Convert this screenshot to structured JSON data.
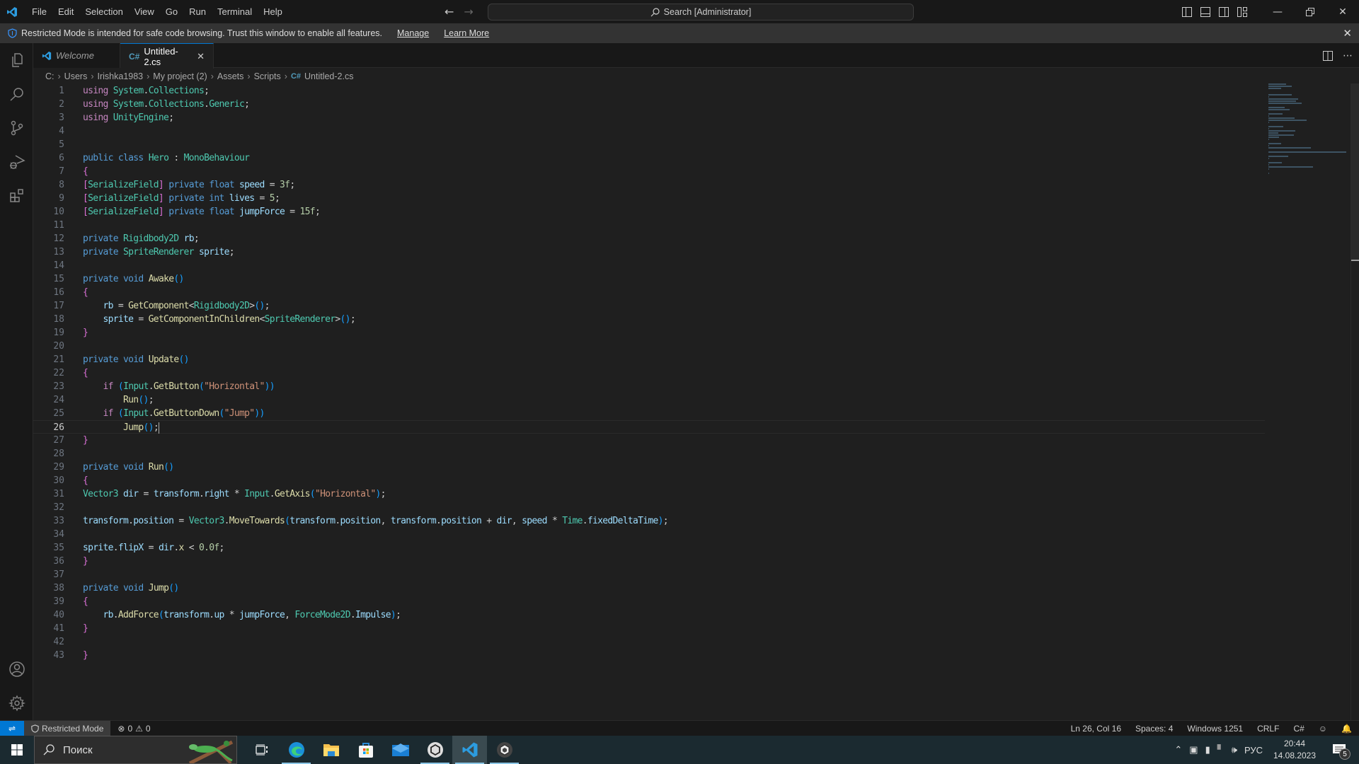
{
  "titlebar": {
    "menu": [
      "File",
      "Edit",
      "Selection",
      "View",
      "Go",
      "Run",
      "Terminal",
      "Help"
    ],
    "search_placeholder": "Search [Administrator]"
  },
  "banner": {
    "message": "Restricted Mode is intended for safe code browsing. Trust this window to enable all features.",
    "manage": "Manage",
    "learn_more": "Learn More"
  },
  "tabs": [
    {
      "label": "Welcome",
      "active": false
    },
    {
      "label": "Untitled-2.cs",
      "active": true
    }
  ],
  "breadcrumb": [
    "C:",
    "Users",
    "Irishka1983",
    "My project (2)",
    "Assets",
    "Scripts",
    "Untitled-2.cs"
  ],
  "editor": {
    "current_line": 26,
    "lines": [
      "using System.Collections;",
      "using System.Collections.Generic;",
      "using UnityEngine;",
      "",
      "",
      "public class Hero : MonoBehaviour",
      "{",
      "[SerializeField] private float speed = 3f;",
      "[SerializeField] private int lives = 5;",
      "[SerializeField] private float jumpForce = 15f;",
      "",
      "private Rigidbody2D rb;",
      "private SpriteRenderer sprite;",
      "",
      "private void Awake()",
      "{",
      "    rb = GetComponent<Rigidbody2D>();",
      "    sprite = GetComponentInChildren<SpriteRenderer>();",
      "}",
      "",
      "private void Update()",
      "{",
      "    if (Input.GetButton(\"Horizontal\"))",
      "        Run();",
      "    if (Input.GetButtonDown(\"Jump\"))",
      "        Jump();",
      "}",
      "",
      "private void Run()",
      "{",
      "Vector3 dir = transform.right * Input.GetAxis(\"Horizontal\");",
      "",
      "transform.position = Vector3.MoveTowards(transform.position, transform.position + dir, speed * Time.fixedDeltaTime);",
      "",
      "sprite.flipX = dir.x < 0.0f;",
      "}",
      "",
      "private void Jump()",
      "{",
      "    rb.AddForce(transform.up * jumpForce, ForceMode2D.Impulse);",
      "}",
      "",
      "}"
    ]
  },
  "statusbar": {
    "restricted": "Restricted Mode",
    "errors": "0",
    "warnings": "0",
    "position": "Ln 26, Col 16",
    "spaces": "Spaces: 4",
    "encoding": "Windows 1251",
    "eol": "CRLF",
    "language": "C#"
  },
  "taskbar": {
    "search_placeholder": "Поиск",
    "apps": [
      "task-view",
      "edge",
      "file-explorer",
      "microsoft-store",
      "mail",
      "unity-hub",
      "vscode",
      "unity"
    ],
    "active_app": "vscode",
    "language": "РУС",
    "time": "20:44",
    "date": "14.08.2023",
    "notifications": "5"
  },
  "colors": {
    "accent": "#0078d4",
    "background": "#1f1f1f",
    "sidebar": "#181818"
  }
}
